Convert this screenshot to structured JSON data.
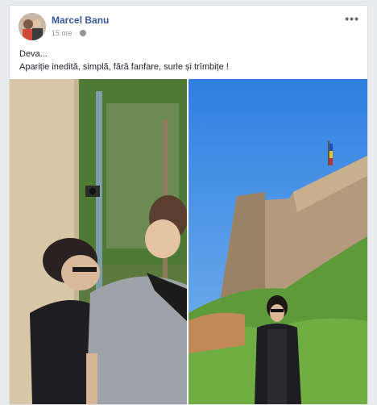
{
  "post": {
    "author": "Marcel Banu",
    "time": "15 ore",
    "separator": "·",
    "privacy_icon": "globe-icon",
    "more_icon": "more-options-icon",
    "more_label": "•••",
    "text_line1": "Deva...",
    "text_line2": "Apariție inedită, simplă, fără fanfare, surle și trîmbițe !"
  },
  "photos": [
    {
      "name": "photo-doorway",
      "subject": "two people at a gate"
    },
    {
      "name": "photo-fortress",
      "subject": "woman in front of fortress walls"
    }
  ],
  "colors": {
    "link": "#365899",
    "meta": "#90949c",
    "sky": "#3d8de8",
    "grass": "#5f9a3a",
    "wall": "#b39a7c"
  }
}
